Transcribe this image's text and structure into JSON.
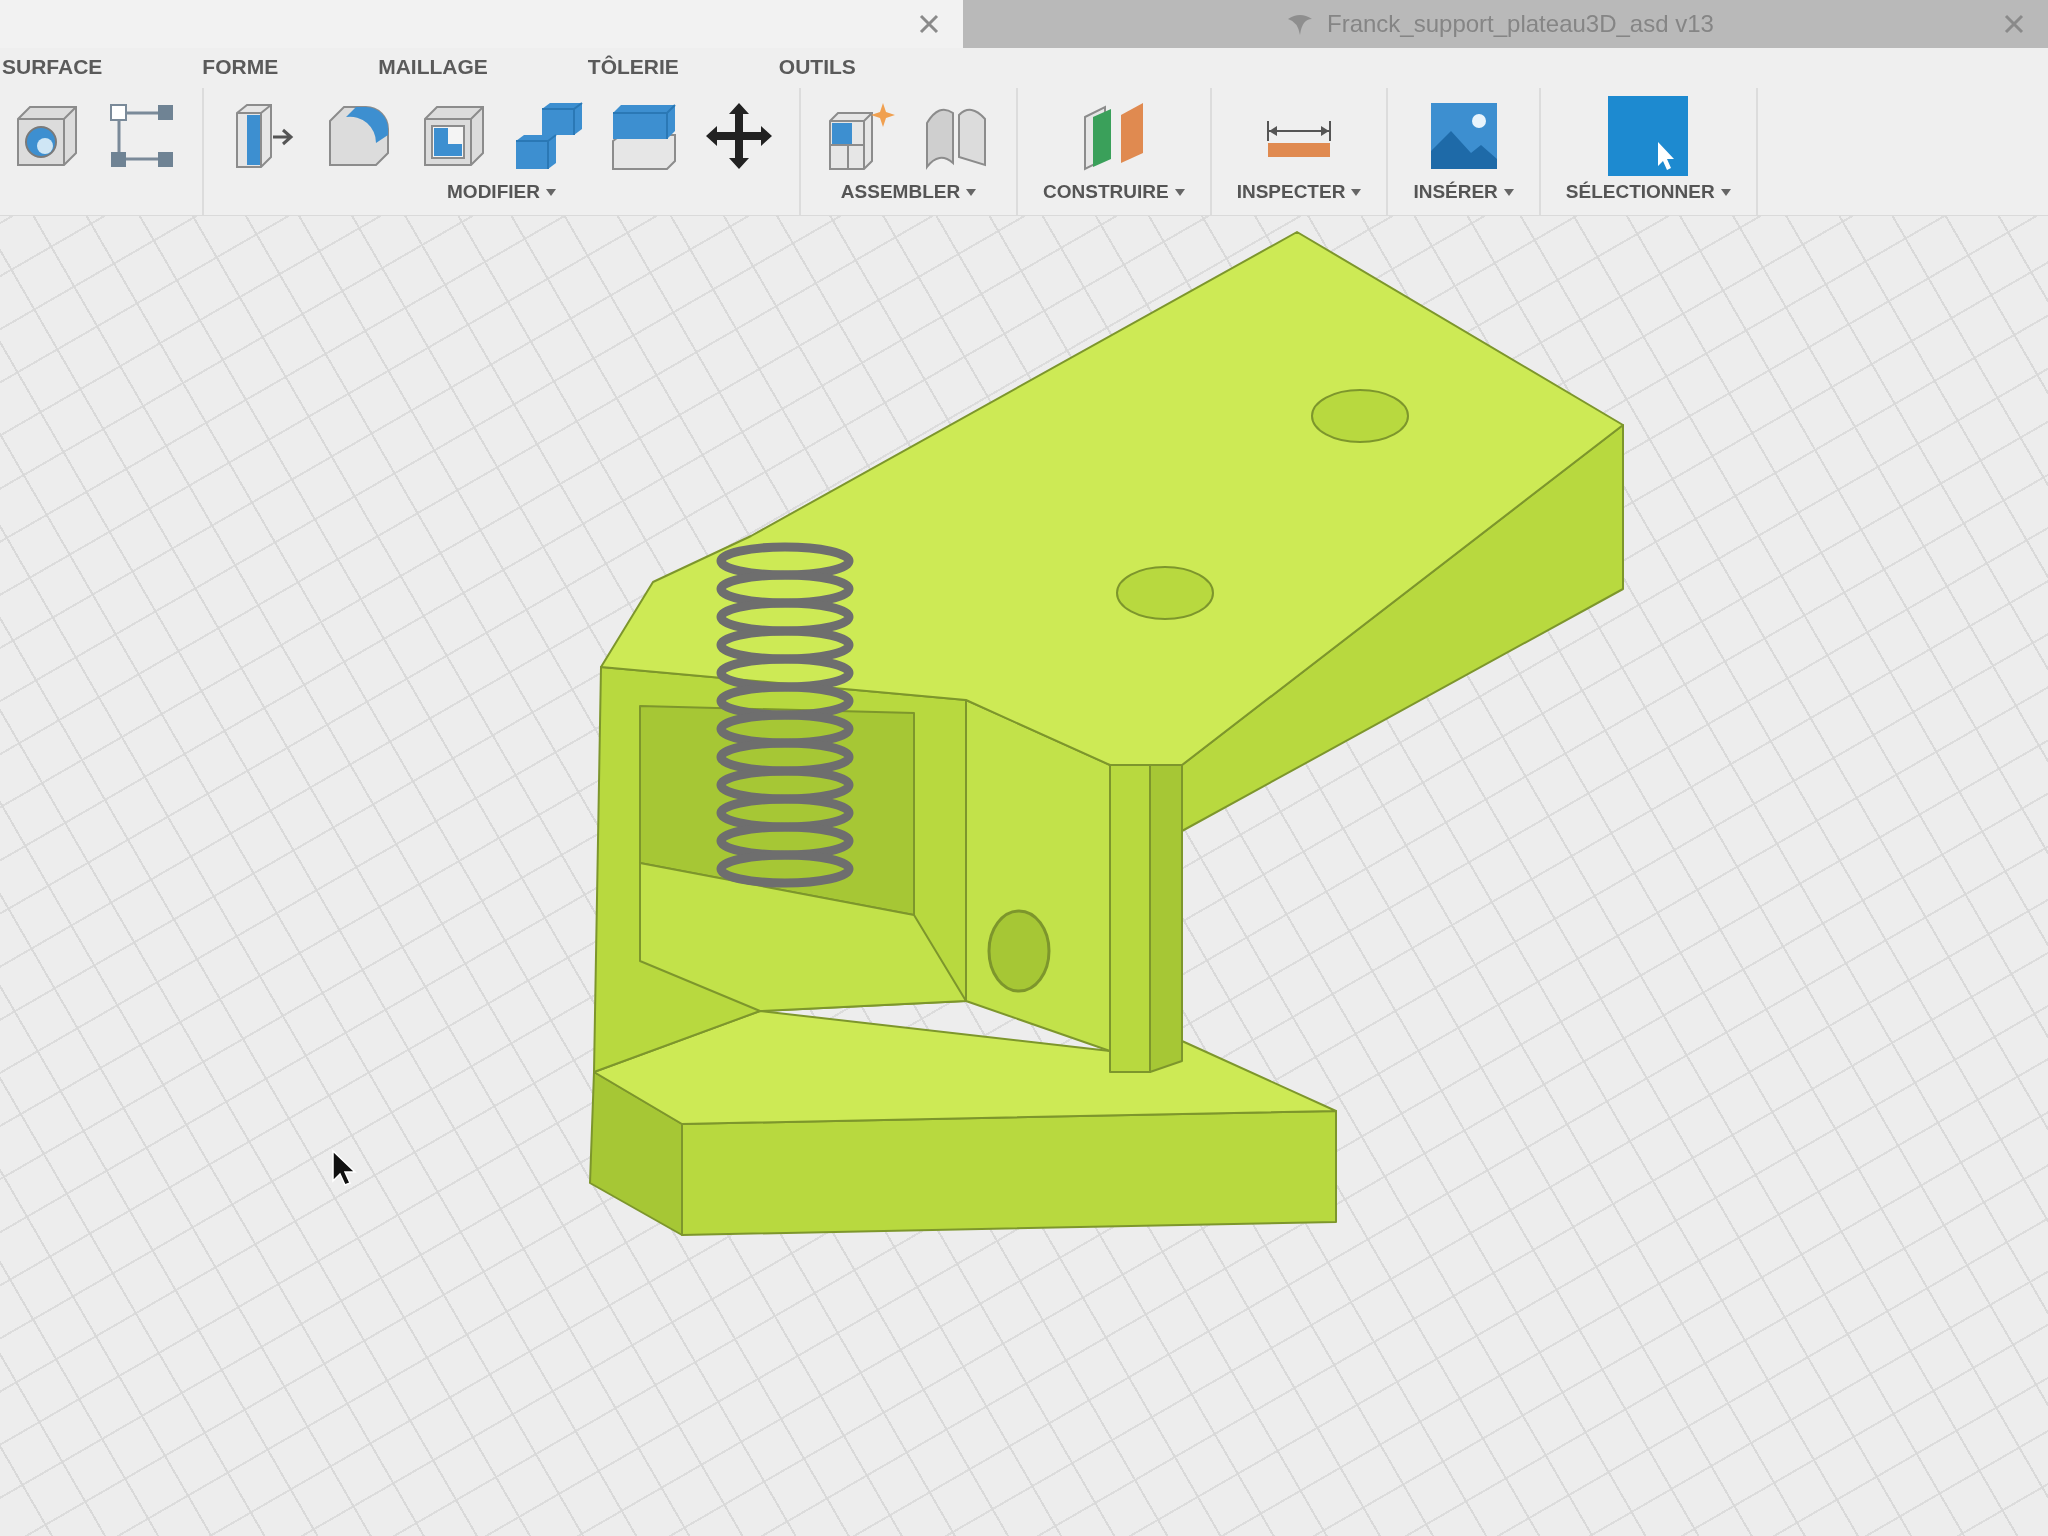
{
  "document_tabs": [
    {
      "selected": true
    },
    {
      "title": "Franck_support_plateau3D_asd v13",
      "selected": false
    }
  ],
  "toolbar": {
    "tabs": [
      {
        "label": "SURFACE",
        "selected": false
      },
      {
        "label": "FORME",
        "selected": false
      },
      {
        "label": "MAILLAGE",
        "selected": false
      },
      {
        "label": "TÔLERIE",
        "selected": false
      },
      {
        "label": "OUTILS",
        "selected": false
      }
    ],
    "groups": [
      {
        "label": "MODIFIER"
      },
      {
        "label": "ASSEMBLER"
      },
      {
        "label": "CONSTRUIRE"
      },
      {
        "label": "INSPECTER"
      },
      {
        "label": "INSÉRER"
      },
      {
        "label": "SÉLECTIONNER"
      }
    ]
  }
}
